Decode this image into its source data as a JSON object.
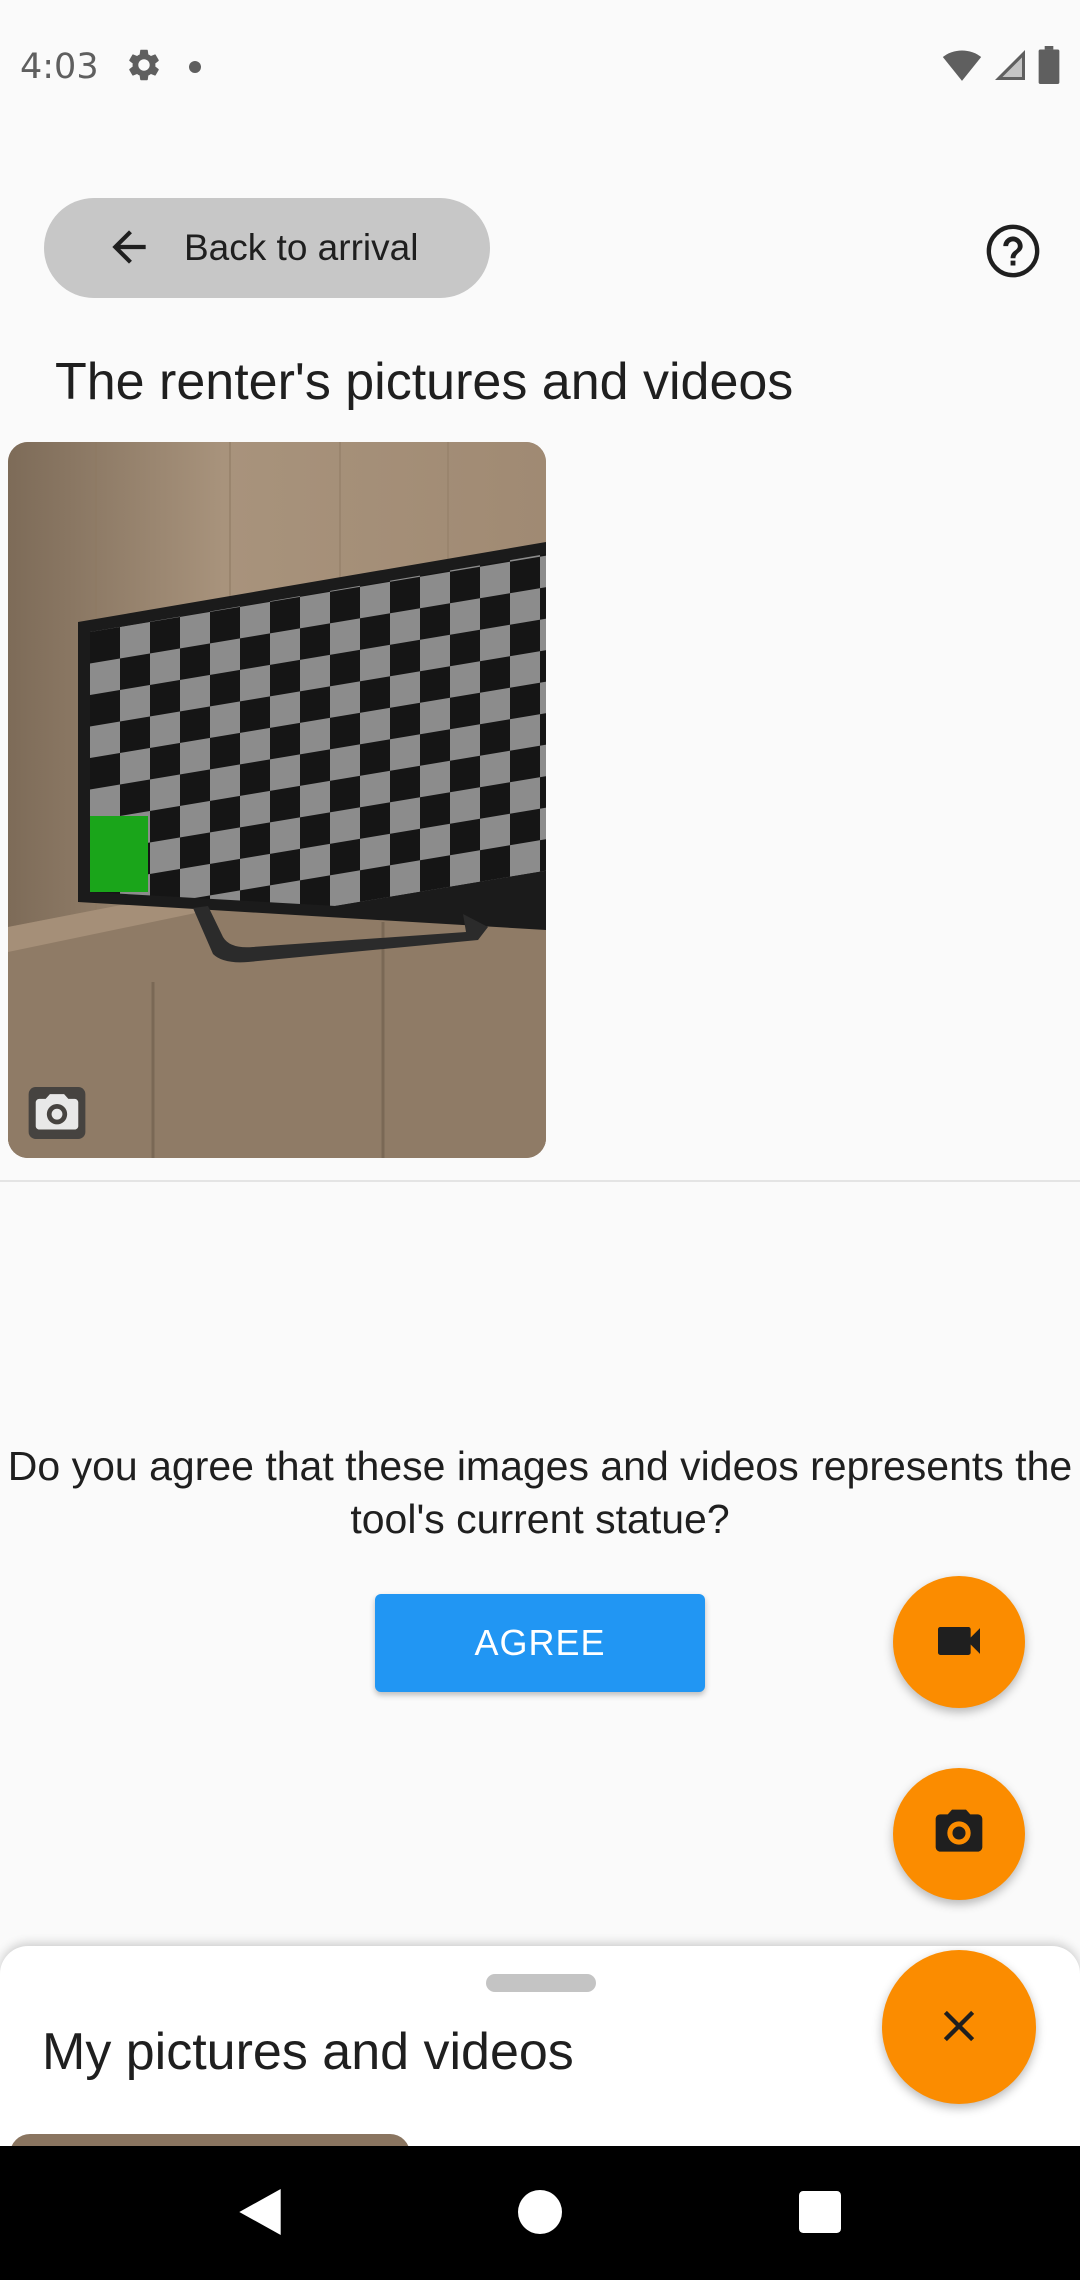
{
  "status_bar": {
    "time": "4:03"
  },
  "header": {
    "back_label": "Back to arrival"
  },
  "renter_section": {
    "title": "The renter's pictures and videos"
  },
  "agreement": {
    "question": "Do you agree that these images and videos represents the tool's current statue?",
    "agree_label": "AGREE"
  },
  "bottom_sheet": {
    "title": "My pictures and videos"
  },
  "colors": {
    "accent_orange": "#fb8c00",
    "primary_blue": "#2196f3",
    "back_button_bg": "#c7c7c7"
  },
  "icons": {
    "settings": "gear-icon",
    "back": "arrow-left-icon",
    "help": "help-circle-icon",
    "video": "videocam-icon",
    "camera": "camera-icon",
    "close": "close-icon"
  }
}
